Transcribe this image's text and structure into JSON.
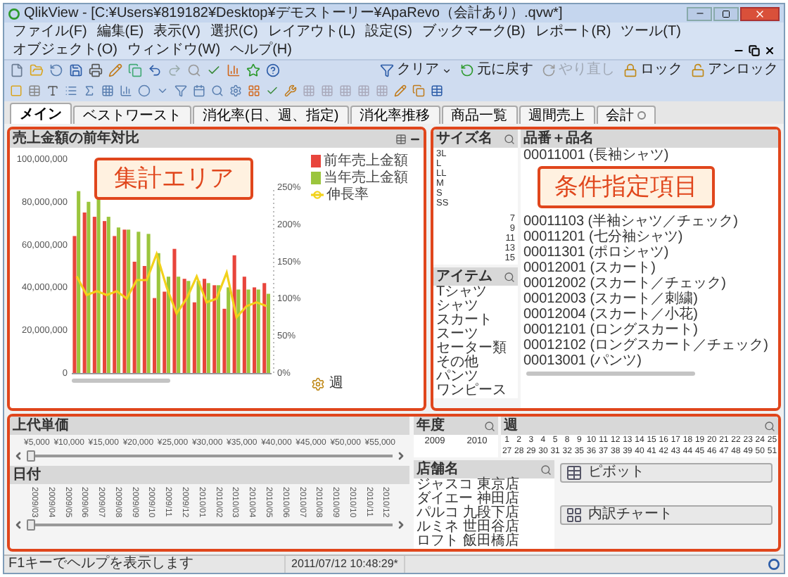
{
  "window": {
    "title": "QlikView - [C:¥Users¥819182¥Desktop¥デモストーリー¥ApaRevo（会計あり）.qvw*]"
  },
  "menu": [
    "ファイル(F)",
    "編集(E)",
    "表示(V)",
    "選択(C)",
    "レイアウト(L)",
    "設定(S)",
    "ブックマーク(B)",
    "レポート(R)",
    "ツール(T)",
    "オブジェクト(O)",
    "ウィンドウ(W)",
    "ヘルプ(H)"
  ],
  "toolbar_right": [
    {
      "label": "クリア",
      "kind": "dropdown",
      "disabled": false
    },
    {
      "label": "元に戻す",
      "kind": "back",
      "disabled": false
    },
    {
      "label": "やり直し",
      "kind": "forward",
      "disabled": true
    },
    {
      "label": "ロック",
      "kind": "lock",
      "disabled": false
    },
    {
      "label": "アンロック",
      "kind": "unlock",
      "disabled": false
    }
  ],
  "tabs": [
    {
      "label": "メイン",
      "selected": true
    },
    {
      "label": "ベストワースト",
      "selected": false
    },
    {
      "label": "消化率(日、週、指定)",
      "selected": false
    },
    {
      "label": "消化率推移",
      "selected": false
    },
    {
      "label": "商品一覧",
      "selected": false
    },
    {
      "label": "週間売上",
      "selected": false
    },
    {
      "label": "会計",
      "selected": false
    }
  ],
  "chart_panel": {
    "title": "売上金額の前年対比",
    "annotation": "集計エリア",
    "chart_data": {
      "type": "bar",
      "xlabel": "週",
      "ylim": [
        0,
        100000000
      ],
      "y2lim": [
        0,
        250
      ],
      "yticks": [
        {
          "value": 0,
          "label": "0"
        },
        {
          "value": 20000000,
          "label": "20,000,000"
        },
        {
          "value": 40000000,
          "label": "40,000,000"
        },
        {
          "value": 60000000,
          "label": "60,000,000"
        },
        {
          "value": 80000000,
          "label": "80,000,000"
        },
        {
          "value": 100000000,
          "label": "100,000,000"
        }
      ],
      "y2ticks": [
        {
          "value": 0,
          "label": "0%"
        },
        {
          "value": 50,
          "label": "50%"
        },
        {
          "value": 100,
          "label": "100%"
        },
        {
          "value": 150,
          "label": "150%"
        },
        {
          "value": 200,
          "label": "200%"
        },
        {
          "value": 250,
          "label": "250%"
        }
      ],
      "series": [
        {
          "name": "前年売上金額",
          "type": "bar",
          "color": "#e8453c",
          "values": [
            64000000,
            75000000,
            73000000,
            71000000,
            64000000,
            67000000,
            52000000,
            50000000,
            35000000,
            38000000,
            58000000,
            44000000,
            33000000,
            44000000,
            41000000,
            30000000,
            55000000,
            45000000,
            40000000,
            42000000
          ]
        },
        {
          "name": "当年売上金額",
          "type": "bar",
          "color": "#9bc53d",
          "values": [
            85000000,
            80000000,
            82000000,
            73000000,
            68000000,
            67000000,
            66000000,
            65000000,
            56000000,
            45000000,
            45000000,
            43000000,
            43000000,
            42000000,
            41000000,
            40000000,
            39000000,
            39000000,
            39000000,
            37000000
          ]
        },
        {
          "name": "伸長率",
          "type": "line",
          "axis": "y2",
          "color": "#f2d21b",
          "values": [
            130,
            105,
            110,
            105,
            110,
            100,
            125,
            125,
            160,
            115,
            80,
            100,
            130,
            95,
            100,
            135,
            75,
            90,
            95,
            90
          ]
        }
      ]
    }
  },
  "filter_panel": {
    "annotation": "条件指定項目"
  },
  "size_list": {
    "title": "サイズ名",
    "items": [
      {
        "label": "3L",
        "kind": "letter"
      },
      {
        "label": "L",
        "kind": "letter"
      },
      {
        "label": "LL",
        "kind": "letter"
      },
      {
        "label": "M",
        "kind": "letter"
      },
      {
        "label": "S",
        "kind": "letter"
      },
      {
        "label": "SS",
        "kind": "letter"
      },
      {
        "label": "7",
        "kind": "number"
      },
      {
        "label": "9",
        "kind": "number"
      },
      {
        "label": "11",
        "kind": "number"
      },
      {
        "label": "13",
        "kind": "number"
      },
      {
        "label": "15",
        "kind": "number"
      }
    ]
  },
  "product_list": {
    "title": "品番＋品名",
    "items_above_note": [
      "00011001 (長袖シャツ)"
    ],
    "items_below_note": [
      "00011103 (半袖シャツ／チェック)",
      "00011201 (七分袖シャツ)",
      "00011301 (ポロシャツ)",
      "00012001 (スカート)",
      "00012002 (スカート／チェック)",
      "00012003 (スカート／刺繍)",
      "00012004 (スカート／小花)",
      "00012101 (ロングスカート)",
      "00012102 (ロングスカート／チェック)",
      "00013001 (パンツ)"
    ]
  },
  "item_list": {
    "title": "アイテム",
    "items": [
      "Tシャツ",
      "シャツ",
      "スカート",
      "スーツ",
      "セーター類",
      "その他",
      "パンツ",
      "ワンピース"
    ]
  },
  "price_slider": {
    "title": "上代単価",
    "ticks": [
      "¥5,000",
      "¥10,000",
      "¥15,000",
      "¥20,000",
      "¥25,000",
      "¥30,000",
      "¥35,000",
      "¥40,000",
      "¥45,000",
      "¥50,000",
      "¥55,000"
    ],
    "level": 0
  },
  "date_slider": {
    "title": "日付",
    "ticks": [
      "2009/03",
      "2009/04",
      "2009/05",
      "2009/06",
      "2009/07",
      "2009/08",
      "2009/09",
      "2009/10",
      "2009/11",
      "2009/12",
      "2010/01",
      "2010/02",
      "2010/03",
      "2010/04",
      "2010/05",
      "2010/06",
      "2010/07",
      "2010/08",
      "2010/09",
      "2010/10",
      "2010/11",
      "2010/12"
    ],
    "level": 0
  },
  "year_list": {
    "title": "年度",
    "items": [
      "2009",
      "2010"
    ]
  },
  "week_list": {
    "title": "週",
    "items": [
      "1",
      "2",
      "3",
      "4",
      "5",
      "8",
      "9",
      "10",
      "11",
      "12",
      "13",
      "14",
      "15",
      "16",
      "17",
      "18",
      "19",
      "20",
      "21",
      "22",
      "23",
      "24",
      "25",
      "27",
      "28",
      "29",
      "30",
      "31",
      "32",
      "35",
      "36",
      "37",
      "38",
      "39",
      "40",
      "41",
      "42",
      "43",
      "44",
      "45",
      "46",
      "47",
      "48",
      "49",
      "50",
      "51"
    ]
  },
  "store_list": {
    "title": "店舗名",
    "items": [
      "ジャスコ 東京店",
      "ダイエー 神田店",
      "パルコ 九段下店",
      "ルミネ 世田谷店",
      "ロフト 飯田橋店"
    ]
  },
  "buttons": [
    {
      "label": "ピボット",
      "kind": "pivot"
    },
    {
      "label": "内訳チャート",
      "kind": "breakdown"
    }
  ],
  "status_bar": {
    "hint": "F1キーでヘルプを表示します",
    "time": "2011/07/12 10:48:29*"
  }
}
